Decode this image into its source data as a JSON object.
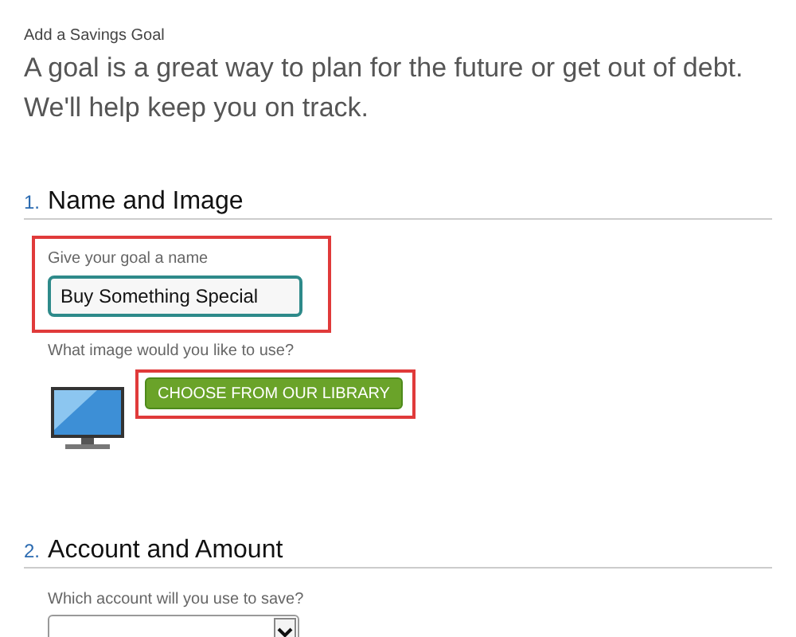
{
  "page_title": "Add a Savings Goal",
  "intro": "A goal is a great way to plan for the future or get out of debt. We'll help keep you on track.",
  "sections": [
    {
      "number": "1.",
      "title": "Name and Image",
      "name_label": "Give your goal a name",
      "name_value": "Buy Something Special",
      "image_label": "What image would you like to use?",
      "library_button": "CHOOSE FROM OUR LIBRARY"
    },
    {
      "number": "2.",
      "title": "Account and Amount",
      "account_label": "Which account will you use to save?"
    }
  ]
}
